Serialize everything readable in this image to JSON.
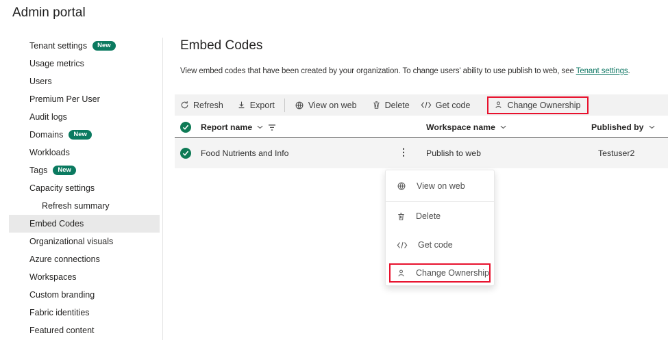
{
  "app": {
    "title": "Admin portal"
  },
  "colors": {
    "badge_green": "#0B7A60",
    "link_green": "#117865",
    "check_green": "#0E7A55",
    "highlight_red": "#E8112D",
    "toolbar_bg": "#F2F2F2",
    "selected_row_bg": "#F4F4F4",
    "sidebar_selected_bg": "#E9E9E9"
  },
  "sidebar": {
    "items": [
      {
        "label": "Tenant settings",
        "badge": "New"
      },
      {
        "label": "Usage metrics"
      },
      {
        "label": "Users"
      },
      {
        "label": "Premium Per User"
      },
      {
        "label": "Audit logs"
      },
      {
        "label": "Domains",
        "badge": "New"
      },
      {
        "label": "Workloads"
      },
      {
        "label": "Tags",
        "badge": "New"
      },
      {
        "label": "Capacity settings"
      },
      {
        "label": "Refresh summary",
        "indent": true
      },
      {
        "label": "Embed Codes",
        "selected": true
      },
      {
        "label": "Organizational visuals"
      },
      {
        "label": "Azure connections"
      },
      {
        "label": "Workspaces"
      },
      {
        "label": "Custom branding"
      },
      {
        "label": "Fabric identities"
      },
      {
        "label": "Featured content"
      }
    ]
  },
  "main": {
    "title": "Embed Codes",
    "description": {
      "prefix": "View embed codes that have been created by your organization. To change users' ability to use publish to web, see ",
      "link": "Tenant settings",
      "suffix": "."
    },
    "toolbar": {
      "refresh": "Refresh",
      "export": "Export",
      "view_on_web": "View on web",
      "delete": "Delete",
      "get_code": "Get code",
      "change_ownership": "Change Ownership"
    },
    "table": {
      "columns": [
        "Report name",
        "Workspace name",
        "Published by"
      ],
      "rows": [
        {
          "report_name": "Food Nutrients and Info",
          "workspace_name": "Publish to web",
          "published_by": "Testuser2"
        }
      ]
    },
    "context_menu": {
      "items": [
        {
          "label": "View on web",
          "icon": "globe-icon"
        },
        {
          "label": "Delete",
          "icon": "trash-icon"
        },
        {
          "label": "Get code",
          "icon": "code-icon"
        },
        {
          "label": "Change Ownership",
          "icon": "person-icon",
          "highlighted": true
        }
      ]
    }
  }
}
